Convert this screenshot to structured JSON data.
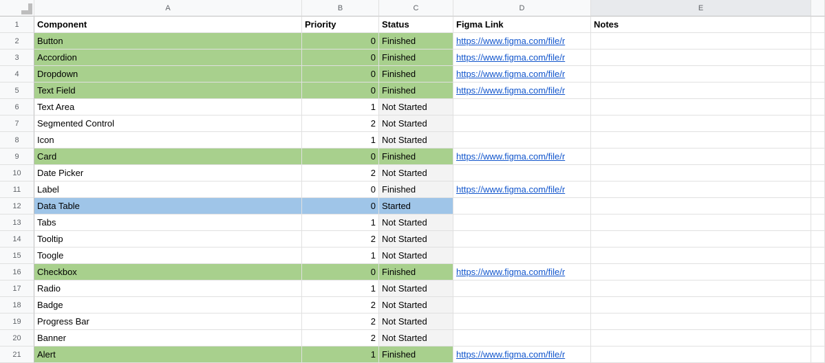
{
  "columns": [
    "A",
    "B",
    "C",
    "D",
    "E"
  ],
  "headers": {
    "component": "Component",
    "priority": "Priority",
    "status": "Status",
    "figma": "Figma Link",
    "notes": "Notes"
  },
  "link_text": "https://www.figma.com/file/r",
  "rows": [
    {
      "n": "2",
      "component": "Button",
      "priority": "0",
      "status": "Finished",
      "color": "green",
      "link": true
    },
    {
      "n": "3",
      "component": "Accordion",
      "priority": "0",
      "status": "Finished",
      "color": "green",
      "link": true
    },
    {
      "n": "4",
      "component": "Dropdown",
      "priority": "0",
      "status": "Finished",
      "color": "green",
      "link": true
    },
    {
      "n": "5",
      "component": "Text Field",
      "priority": "0",
      "status": "Finished",
      "color": "green",
      "link": true
    },
    {
      "n": "6",
      "component": "Text Area",
      "priority": "1",
      "status": "Not Started",
      "color": "",
      "link": false
    },
    {
      "n": "7",
      "component": "Segmented Control",
      "priority": "2",
      "status": "Not Started",
      "color": "",
      "link": false
    },
    {
      "n": "8",
      "component": "Icon",
      "priority": "1",
      "status": "Not Started",
      "color": "",
      "link": false
    },
    {
      "n": "9",
      "component": "Card",
      "priority": "0",
      "status": "Finished",
      "color": "green",
      "link": true
    },
    {
      "n": "10",
      "component": "Date Picker",
      "priority": "2",
      "status": "Not Started",
      "color": "",
      "link": false
    },
    {
      "n": "11",
      "component": "Label",
      "priority": "0",
      "status": "Finished",
      "color": "",
      "link": true
    },
    {
      "n": "12",
      "component": "Data Table",
      "priority": "0",
      "status": "Started",
      "color": "blue",
      "link": false
    },
    {
      "n": "13",
      "component": "Tabs",
      "priority": "1",
      "status": "Not Started",
      "color": "",
      "link": false
    },
    {
      "n": "14",
      "component": "Tooltip",
      "priority": "2",
      "status": "Not Started",
      "color": "",
      "link": false
    },
    {
      "n": "15",
      "component": "Toogle",
      "priority": "1",
      "status": "Not Started",
      "color": "",
      "link": false
    },
    {
      "n": "16",
      "component": "Checkbox",
      "priority": "0",
      "status": "Finished",
      "color": "green",
      "link": true
    },
    {
      "n": "17",
      "component": "Radio",
      "priority": "1",
      "status": "Not Started",
      "color": "",
      "link": false
    },
    {
      "n": "18",
      "component": "Badge",
      "priority": "2",
      "status": "Not Started",
      "color": "",
      "link": false
    },
    {
      "n": "19",
      "component": "Progress Bar",
      "priority": "2",
      "status": "Not Started",
      "color": "",
      "link": false
    },
    {
      "n": "20",
      "component": "Banner",
      "priority": "2",
      "status": "Not Started",
      "color": "",
      "link": false
    },
    {
      "n": "21",
      "component": "Alert",
      "priority": "1",
      "status": "Finished",
      "color": "green",
      "link": true,
      "partial": true
    }
  ]
}
